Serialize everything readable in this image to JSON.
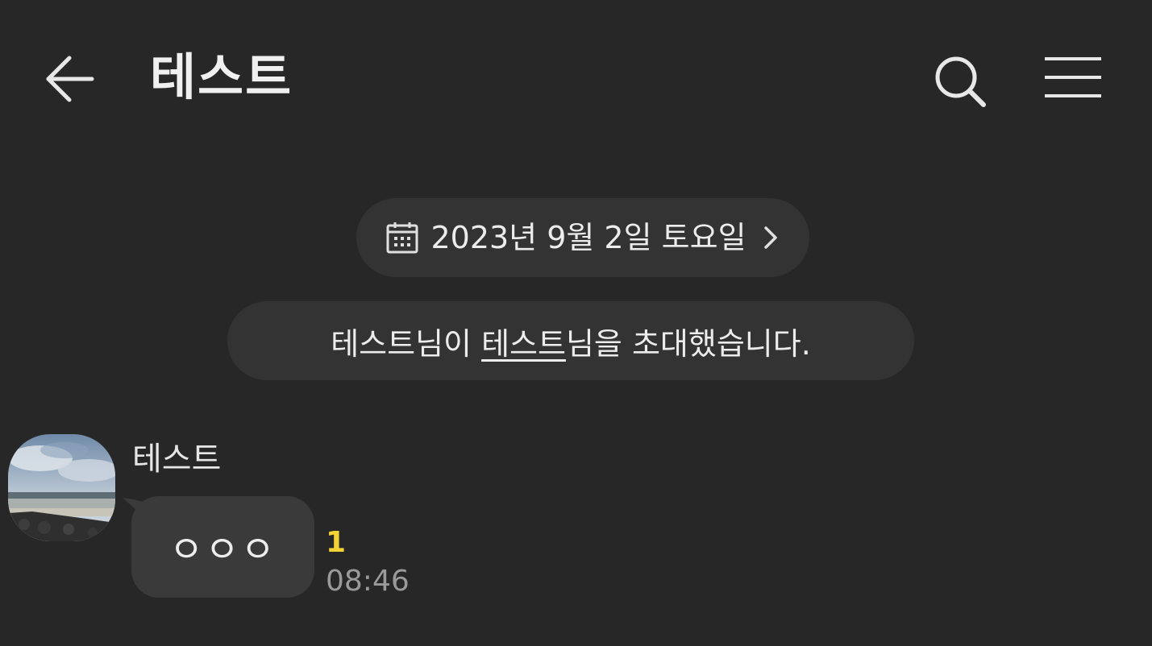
{
  "header": {
    "title": "테스트",
    "back_icon": "arrow-left-icon",
    "search_icon": "search-icon",
    "menu_icon": "hamburger-menu-icon"
  },
  "date_chip": {
    "icon": "calendar-icon",
    "label": "2023년 9월 2일 토요일",
    "chevron": "chevron-right-icon"
  },
  "notice": {
    "actor": "테스트",
    "suffix_1": "님이 ",
    "invitee": "테스트",
    "suffix_2": "님을 초대했습니다."
  },
  "message": {
    "sender": "테스트",
    "text": "ㅇㅇㅇ",
    "unread_count": "1",
    "time": "08:46"
  },
  "colors": {
    "background": "#272727",
    "chip": "#333333",
    "bubble": "#3a3a3a",
    "unread": "#f2d335",
    "time": "#9a9a9a"
  }
}
